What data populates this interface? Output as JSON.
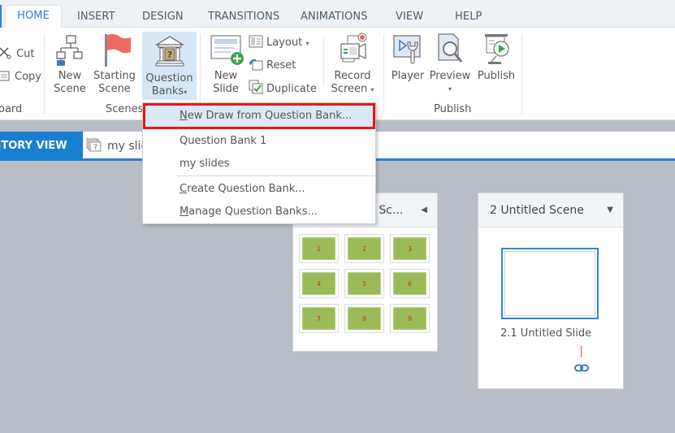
{
  "ribbon_tabs": [
    "HOME",
    "INSERT",
    "DESIGN",
    "TRANSITIONS",
    "ANIMATIONS",
    "VIEW",
    "HELP"
  ],
  "active_tab": "HOME",
  "clipboard": {
    "cut_label": "Cut",
    "copy_label": "Copy",
    "group_label": "oard"
  },
  "scenes_group": {
    "new_scene_line1": "New",
    "new_scene_line2": "Scene",
    "starting_scene_line1": "Starting",
    "starting_scene_line2": "Scene",
    "question_banks_line1": "Question",
    "question_banks_line2": "Banks",
    "group_label": "Scenes"
  },
  "slides_group": {
    "new_slide_line1": "New",
    "new_slide_line2": "Slide",
    "layout_label": "Layout",
    "reset_label": "Reset",
    "duplicate_label": "Duplicate",
    "record_line1": "Record",
    "record_line2": "Screen"
  },
  "publish_group": {
    "player_label": "Player",
    "preview_label": "Preview",
    "publish_label": "Publish",
    "group_label": "Publish"
  },
  "viewbar": {
    "story_view_label": "STORY VIEW",
    "slide_tab_label": "my slides"
  },
  "dropdown": {
    "items": [
      {
        "access_key": "N",
        "rest": "ew Draw from Question Bank...",
        "highlighted": true
      },
      {
        "label": "Question Bank 1"
      },
      {
        "label": "my slides"
      },
      {
        "access_key": "C",
        "rest": "reate Question Bank..."
      },
      {
        "access_key": "M",
        "rest": "anage Question Banks..."
      }
    ]
  },
  "scene1": {
    "title_visible": "d Sc...",
    "thumbnails": [
      "1",
      "2",
      "3",
      "4",
      "5",
      "6",
      "7",
      "8",
      "9"
    ]
  },
  "scene2": {
    "title": "2 Untitled Scene",
    "slide_label": "2.1 Untitled Slide"
  },
  "colors": {
    "accent": "#2a7fd4",
    "highlight_border": "#e8161b",
    "thumb_green": "#9bbb59",
    "thumb_number": "#d72d1f"
  }
}
